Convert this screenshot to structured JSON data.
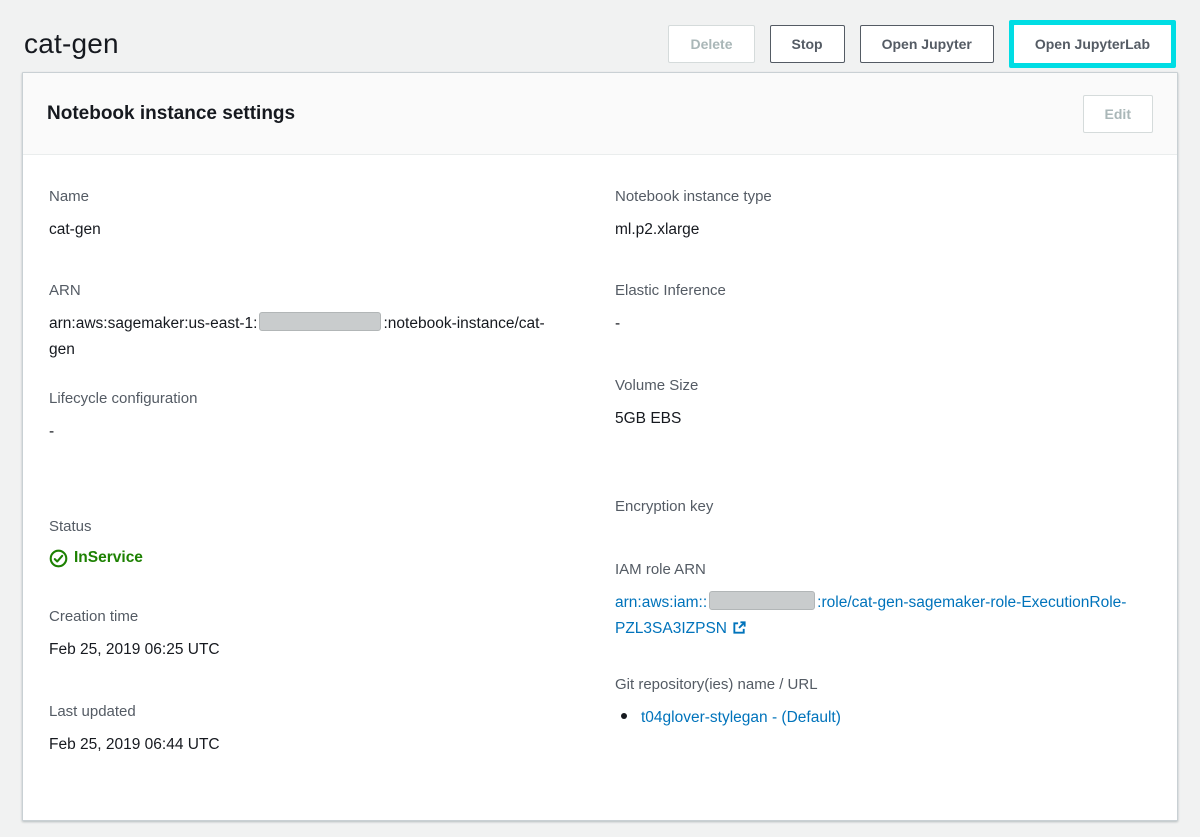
{
  "page": {
    "title": "cat-gen"
  },
  "header_actions": {
    "delete_label": "Delete",
    "stop_label": "Stop",
    "open_jupyter_label": "Open Jupyter",
    "open_jupyterlab_label": "Open JupyterLab"
  },
  "panel": {
    "title": "Notebook instance settings",
    "edit_label": "Edit"
  },
  "left": {
    "name": {
      "label": "Name",
      "value": "cat-gen"
    },
    "arn": {
      "label": "ARN",
      "value_prefix": "arn:aws:sagemaker:us-east-1:",
      "account_id_redacted": true,
      "value_suffix": ":notebook-instance/cat-gen"
    },
    "lifecycle": {
      "label": "Lifecycle configuration",
      "value": "-"
    },
    "status": {
      "label": "Status",
      "value": "InService"
    },
    "creation_time": {
      "label": "Creation time",
      "value": "Feb 25, 2019 06:25 UTC"
    },
    "last_updated": {
      "label": "Last updated",
      "value": "Feb 25, 2019 06:44 UTC"
    }
  },
  "right": {
    "instance_type": {
      "label": "Notebook instance type",
      "value": "ml.p2.xlarge"
    },
    "elastic_inference": {
      "label": "Elastic Inference",
      "value": "-"
    },
    "volume_size": {
      "label": "Volume Size",
      "value": "5GB EBS"
    },
    "encryption_key": {
      "label": "Encryption key",
      "value": ""
    },
    "iam_role": {
      "label": "IAM role ARN",
      "link_prefix": "arn:aws:iam::",
      "account_id_redacted": true,
      "link_suffix": ":role/cat-gen-sagemaker-role-ExecutionRole-PZL3SA3IZPSN"
    },
    "git_repos": {
      "label": "Git repository(ies) name / URL",
      "items": [
        {
          "link": "t04glover-stylegan - (Default)"
        }
      ]
    }
  },
  "icons": {
    "status_ok": "check-circle-icon",
    "external_link": "external-link-icon"
  },
  "colors": {
    "link_blue": "#0073bb",
    "status_green": "#1d8102",
    "highlight_cyan": "#00dde4"
  }
}
